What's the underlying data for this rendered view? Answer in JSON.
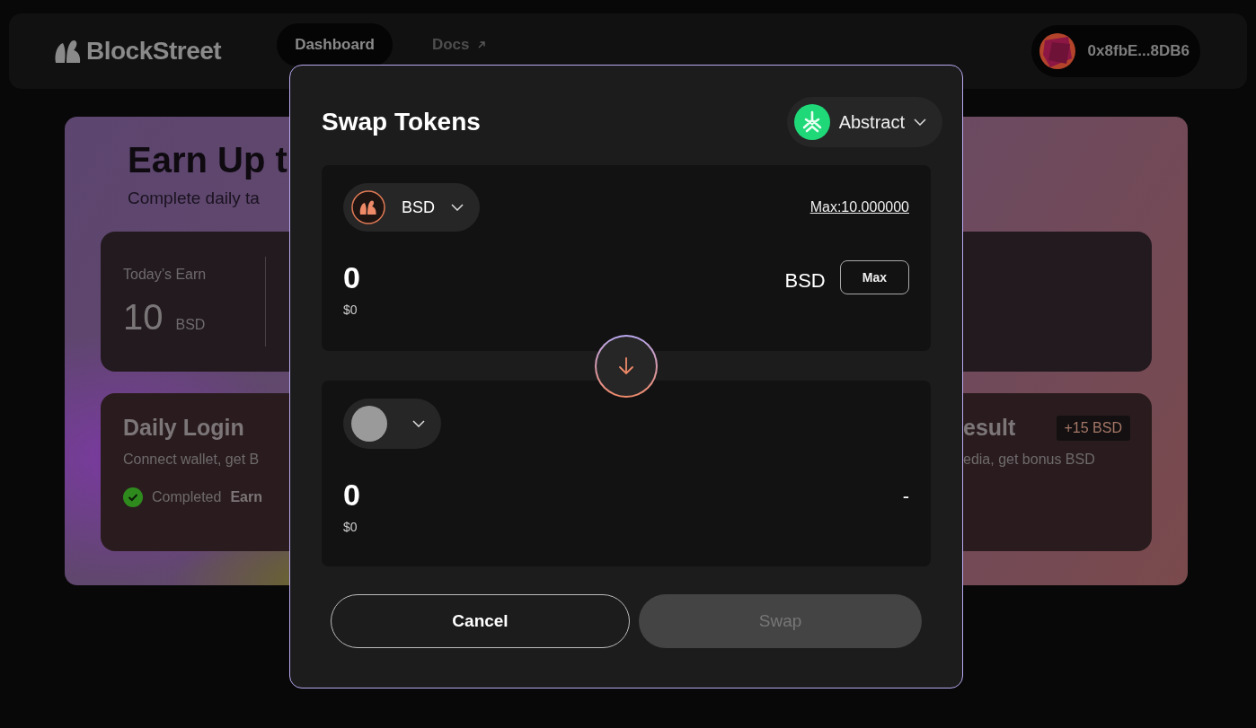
{
  "header": {
    "logo": "BlockStreet",
    "nav": [
      {
        "label": "Dashboard",
        "selected": true,
        "external": false
      },
      {
        "label": "Docs",
        "selected": false,
        "external": true
      }
    ],
    "wallet": "0x8fbE...8DB6"
  },
  "hero": {
    "title": "Earn Up t",
    "subtitle": "Complete daily ta",
    "stat": {
      "label": "Today’s Earn",
      "value": "10",
      "unit": "BSD"
    },
    "tasks": [
      {
        "title": "Daily Login",
        "description": "Connect wallet, get B",
        "completed": true,
        "status": "Completed",
        "reward": "Earn"
      },
      {
        "title": "esult",
        "description": "edia, get bonus BSD",
        "badge": "+15 BSD"
      }
    ]
  },
  "modal": {
    "title": "Swap Tokens",
    "network": "Abstract",
    "from": {
      "token": "BSD",
      "max_link": "Max:10.000000",
      "amount": "0",
      "usd": "$0",
      "unit": "BSD",
      "max_button": "Max"
    },
    "to": {
      "amount": "0",
      "usd": "$0",
      "unit": "-"
    },
    "buttons": [
      {
        "label": "Cancel",
        "kind": "secondary",
        "disabled": false
      },
      {
        "label": "Swap",
        "kind": "primary",
        "disabled": true
      }
    ]
  }
}
